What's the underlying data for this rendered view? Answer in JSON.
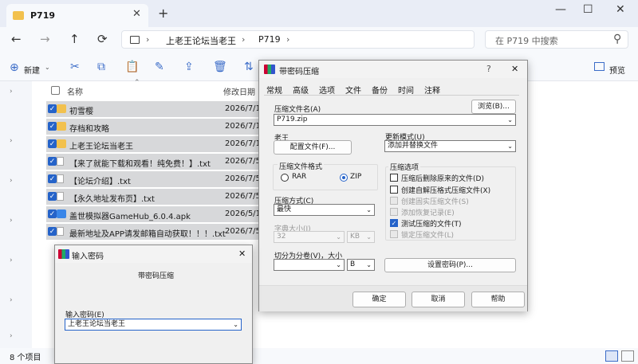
{
  "window": {
    "tab_title": "P719",
    "close": "✕",
    "new_tab": "+",
    "min": "—",
    "max": "☐",
    "win_close": "✕"
  },
  "nav": {
    "back": "←",
    "forward": "→",
    "up": "↑",
    "refresh": "⟳",
    "breadcrumb": [
      "上老王论坛当老王",
      "P719"
    ],
    "search_placeholder": "在 P719 中搜索"
  },
  "toolbar": {
    "new_label": "新建",
    "preview_label": "预览"
  },
  "table": {
    "headers": {
      "name": "名称",
      "date": "修改日期"
    },
    "rows": [
      {
        "name": "初雪樱",
        "date": "2026/7/1",
        "icon": "folder-icon"
      },
      {
        "name": "存档和攻略",
        "date": "2026/7/1",
        "icon": "folder-icon"
      },
      {
        "name": "上老王论坛当老王",
        "date": "2026/7/1",
        "icon": "folder-icon"
      },
      {
        "name": "【来了就能下载和观看！纯免费！】.txt",
        "date": "2026/7/5",
        "icon": "text-file-icon"
      },
      {
        "name": "【论坛介绍】.txt",
        "date": "2026/7/5",
        "icon": "text-file-icon"
      },
      {
        "name": "【永久地址发布页】.txt",
        "date": "2026/7/5",
        "icon": "text-file-icon"
      },
      {
        "name": "盖世模拟器GameHub_6.0.4.apk",
        "date": "2026/5/1",
        "icon": "apk-icon"
      },
      {
        "name": "最新地址及APP请发邮箱自动获取！！！.txt",
        "date": "2026/7/5",
        "icon": "text-file-icon"
      }
    ]
  },
  "status": {
    "item_count": "8 个项目"
  },
  "archive_dialog": {
    "title": "带密码压缩",
    "help": "?",
    "close": "✕",
    "tabs": [
      "常规",
      "高级",
      "选项",
      "文件",
      "备份",
      "时间",
      "注释"
    ],
    "archive_name_label": "压缩文件名(A)",
    "browse_button": "浏览(B)...",
    "archive_name": "P719.zip",
    "profile_label": "老王",
    "profile_button": "配置文件(F)...",
    "update_mode_label": "更新模式(U)",
    "update_mode": "添加并替换文件",
    "format_label": "压缩文件格式",
    "format_rar": "RAR",
    "format_zip": "ZIP",
    "method_label": "压缩方式(C)",
    "method": "最快",
    "dict_label": "字典大小(I)",
    "dict_size": "32",
    "dict_unit": "KB",
    "split_label": "切分为分卷(V)，大小",
    "split_unit": "B",
    "options_label": "压缩选项",
    "options": [
      {
        "label": "压缩后删除原来的文件(D)",
        "checked": false,
        "disabled": false
      },
      {
        "label": "创建自解压格式压缩文件(X)",
        "checked": false,
        "disabled": false
      },
      {
        "label": "创建固实压缩文件(S)",
        "checked": false,
        "disabled": true
      },
      {
        "label": "添加恢复记录(E)",
        "checked": false,
        "disabled": true
      },
      {
        "label": "测试压缩的文件(T)",
        "checked": true,
        "disabled": false
      },
      {
        "label": "锁定压缩文件(L)",
        "checked": false,
        "disabled": true
      }
    ],
    "set_password_button": "设置密码(P)...",
    "ok": "确定",
    "cancel": "取消",
    "help_button": "帮助"
  },
  "password_dialog": {
    "title": "输入密码",
    "close": "✕",
    "subtitle": "带密码压缩",
    "field_label": "输入密码(E)",
    "value": "上老王论坛当老王"
  }
}
